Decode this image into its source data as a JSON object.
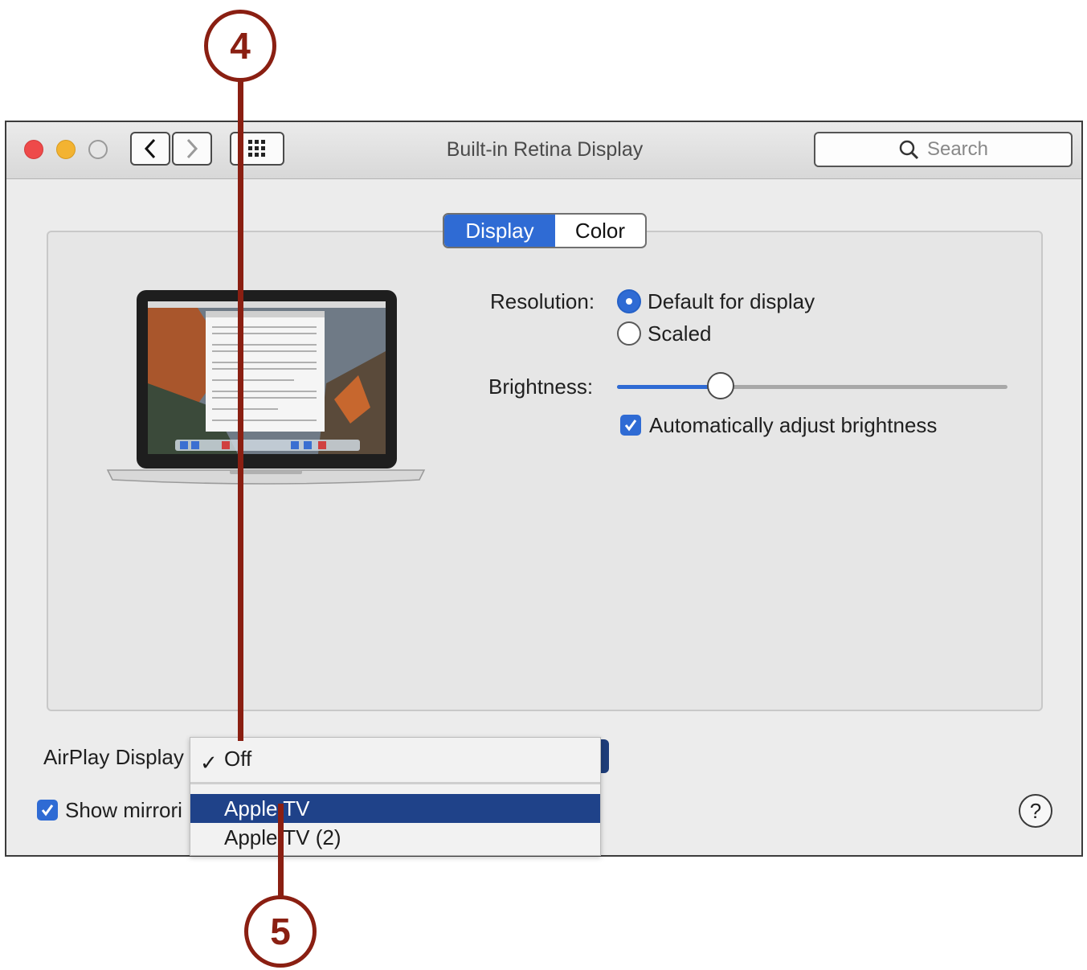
{
  "window": {
    "title": "Built-in Retina Display",
    "search_placeholder": "Search"
  },
  "tabs": [
    {
      "label": "Display",
      "selected": true
    },
    {
      "label": "Color",
      "selected": false
    }
  ],
  "resolution": {
    "label": "Resolution:",
    "options": [
      {
        "label": "Default for display",
        "selected": true
      },
      {
        "label": "Scaled",
        "selected": false
      }
    ]
  },
  "brightness": {
    "label": "Brightness:",
    "value_fraction": 0.27,
    "auto_adjust_label": "Automatically adjust brightness",
    "auto_adjust_checked": true
  },
  "airplay": {
    "label": "AirPlay Display",
    "menu_items": [
      {
        "label": "Off",
        "checked": true
      },
      {
        "label": "Apple TV",
        "highlighted": true
      },
      {
        "label": "Apple TV (2)",
        "highlighted": false
      }
    ]
  },
  "mirroring": {
    "label": "Show mirrori",
    "checked": true
  },
  "help_label": "?",
  "callouts": [
    "4",
    "5"
  ],
  "colors": {
    "accent": "#2f6bd4",
    "menu_highlight": "#1f4289",
    "callout": "#8a1f12"
  }
}
